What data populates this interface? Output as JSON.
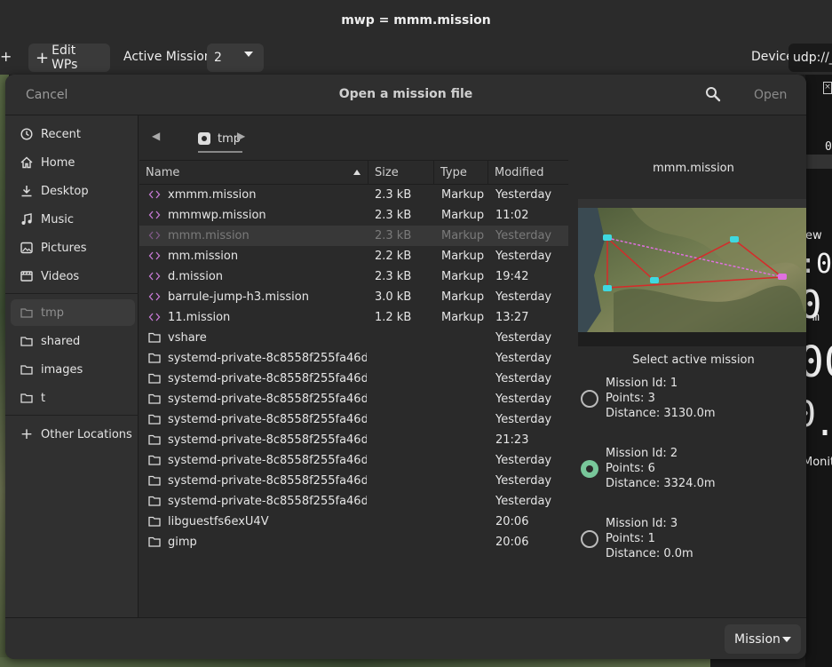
{
  "window": {
    "title": "mwp = mmm.mission"
  },
  "toolbar": {
    "add_symbol": "+",
    "edit_wps": "Edit WPs",
    "active_mission_label": "Active Mission",
    "active_mission_value": "2",
    "device_label": "Device",
    "device_value": "udp://__"
  },
  "right_panel": {
    "fragments": [
      "0",
      "ew",
      ":0",
      "0",
      "m",
      "00",
      "0",
      ".",
      "Monit"
    ]
  },
  "dialog": {
    "cancel": "Cancel",
    "title": "Open a mission file",
    "open": "Open"
  },
  "sidebar": {
    "items": [
      {
        "label": "Recent",
        "icon": "clock-icon"
      },
      {
        "label": "Home",
        "icon": "home-icon"
      },
      {
        "label": "Desktop",
        "icon": "desktop-icon"
      },
      {
        "label": "Music",
        "icon": "music-icon"
      },
      {
        "label": "Pictures",
        "icon": "pictures-icon"
      },
      {
        "label": "Videos",
        "icon": "videos-icon"
      }
    ],
    "bookmarks": [
      {
        "label": "tmp",
        "selected": true
      },
      {
        "label": "shared"
      },
      {
        "label": "images"
      },
      {
        "label": "t"
      }
    ],
    "other_locations": "Other Locations"
  },
  "pathbar": {
    "crumb": "tmp"
  },
  "file_list": {
    "headers": {
      "name": "Name",
      "size": "Size",
      "type": "Type",
      "modified": "Modified"
    },
    "rows": [
      {
        "name": "xmmm.mission",
        "size": "2.3 kB",
        "type": "Markup",
        "modified": "Yesterday",
        "kind": "markup"
      },
      {
        "name": "mmmwp.mission",
        "size": "2.3 kB",
        "type": "Markup",
        "modified": "11:02",
        "kind": "markup"
      },
      {
        "name": "mmm.mission",
        "size": "2.3 kB",
        "type": "Markup",
        "modified": "Yesterday",
        "kind": "markup",
        "dim": true
      },
      {
        "name": "mm.mission",
        "size": "2.2 kB",
        "type": "Markup",
        "modified": "Yesterday",
        "kind": "markup"
      },
      {
        "name": "d.mission",
        "size": "2.3 kB",
        "type": "Markup",
        "modified": "19:42",
        "kind": "markup"
      },
      {
        "name": "barrule-jump-h3.mission",
        "size": "3.0 kB",
        "type": "Markup",
        "modified": "Yesterday",
        "kind": "markup"
      },
      {
        "name": "11.mission",
        "size": "1.2 kB",
        "type": "Markup",
        "modified": "13:27",
        "kind": "markup"
      },
      {
        "name": "vshare",
        "size": "",
        "type": "",
        "modified": "Yesterday",
        "kind": "folder"
      },
      {
        "name": "systemd-private-8c8558f255fa46d…",
        "size": "",
        "type": "",
        "modified": "Yesterday",
        "kind": "folder"
      },
      {
        "name": "systemd-private-8c8558f255fa46d…",
        "size": "",
        "type": "",
        "modified": "Yesterday",
        "kind": "folder"
      },
      {
        "name": "systemd-private-8c8558f255fa46d…",
        "size": "",
        "type": "",
        "modified": "Yesterday",
        "kind": "folder"
      },
      {
        "name": "systemd-private-8c8558f255fa46d…",
        "size": "",
        "type": "",
        "modified": "Yesterday",
        "kind": "folder"
      },
      {
        "name": "systemd-private-8c8558f255fa46d…",
        "size": "",
        "type": "",
        "modified": "21:23",
        "kind": "folder"
      },
      {
        "name": "systemd-private-8c8558f255fa46d…",
        "size": "",
        "type": "",
        "modified": "Yesterday",
        "kind": "folder"
      },
      {
        "name": "systemd-private-8c8558f255fa46d…",
        "size": "",
        "type": "",
        "modified": "Yesterday",
        "kind": "folder"
      },
      {
        "name": "systemd-private-8c8558f255fa46d…",
        "size": "",
        "type": "",
        "modified": "Yesterday",
        "kind": "folder"
      },
      {
        "name": "libguestfs6exU4V",
        "size": "",
        "type": "",
        "modified": "20:06",
        "kind": "folder"
      },
      {
        "name": "gimp",
        "size": "",
        "type": "",
        "modified": "20:06",
        "kind": "folder"
      }
    ]
  },
  "preview": {
    "title": "mmm.mission",
    "select_label": "Select active mission",
    "missions": [
      {
        "id": "Mission Id: 1",
        "points": "Points: 3",
        "distance": "Distance: 3130.0m",
        "selected": false
      },
      {
        "id": "Mission Id: 2",
        "points": "Points: 6",
        "distance": "Distance: 3324.0m",
        "selected": true
      },
      {
        "id": "Mission Id: 3",
        "points": "Points: 1",
        "distance": "Distance: 0.0m",
        "selected": false
      }
    ]
  },
  "footer": {
    "filter": "Mission"
  },
  "colors": {
    "accent_green": "#78c79a",
    "markup_icon": "#c77ad6",
    "route_red": "#d62a2a",
    "route_pink": "#e070e0",
    "wp_cyan": "#3fd8e0"
  }
}
